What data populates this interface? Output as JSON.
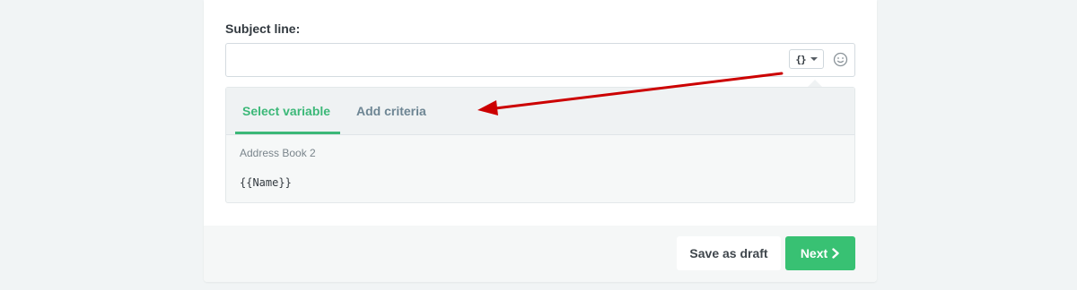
{
  "form": {
    "subject_label": "Subject line:",
    "subject_value": "",
    "variable_button_icon": "{}",
    "emoji_icon": "smiley-icon"
  },
  "variable_dropdown": {
    "tabs": [
      {
        "label": "Select variable",
        "active": true
      },
      {
        "label": "Add criteria",
        "active": false
      }
    ],
    "address_book": "Address Book 2",
    "variables": [
      "{{Name}}"
    ]
  },
  "footer": {
    "save_draft_label": "Save as draft",
    "next_label": "Next"
  },
  "colors": {
    "accent_green": "#3cb878",
    "annotation_red": "#cc0000"
  }
}
